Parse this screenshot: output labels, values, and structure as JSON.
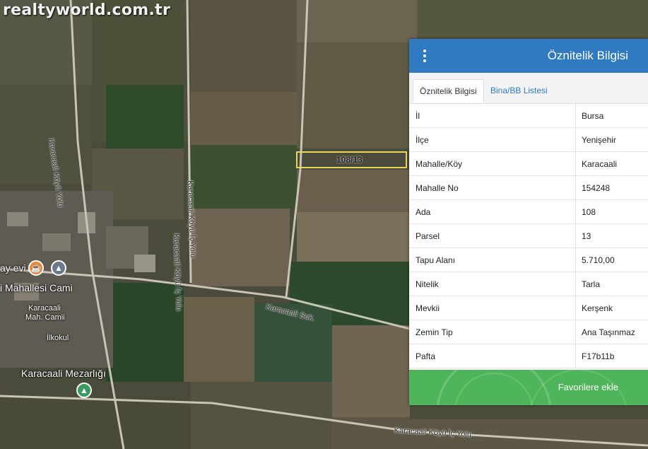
{
  "map": {
    "watermark": "realtyworld.com.tr",
    "parcel_label": "108/13",
    "labels": [
      {
        "text": "Karacaali Köyü Yolu"
      },
      {
        "text": "Karacaali Köyü İç Yolu"
      },
      {
        "text": "Karacaali Köyü İç Yolu"
      },
      {
        "text": "Karacaali Sok."
      },
      {
        "text": "Karacaali Köyü İç Yolu"
      },
      {
        "text": "ay evi"
      },
      {
        "text": "i Mahallesi Cami"
      },
      {
        "text": "Karacaali"
      },
      {
        "text": "Mah. Camii"
      },
      {
        "text": "İlkokul"
      },
      {
        "text": "Karacaali Mezarlığı"
      }
    ]
  },
  "panel": {
    "title": "Öznitelik Bilgisi",
    "tabs": [
      {
        "label": "Öznitelik Bilgisi",
        "active": true
      },
      {
        "label": "Bina/BB Listesi",
        "active": false
      }
    ],
    "rows": [
      {
        "key": "İl",
        "value": "Bursa"
      },
      {
        "key": "İlçe",
        "value": "Yenişehir"
      },
      {
        "key": "Mahalle/Köy",
        "value": "Karacaali"
      },
      {
        "key": "Mahalle No",
        "value": "154248"
      },
      {
        "key": "Ada",
        "value": "108"
      },
      {
        "key": "Parsel",
        "value": "13"
      },
      {
        "key": "Tapu Alanı",
        "value": "5.710,00"
      },
      {
        "key": "Nitelik",
        "value": "Tarla"
      },
      {
        "key": "Mevkii",
        "value": "Kerşenk"
      },
      {
        "key": "Zemin Tip",
        "value": "Ana Taşınmaz"
      },
      {
        "key": "Pafta",
        "value": "F17b11b"
      }
    ],
    "favorite_button": "Favorilere ekle"
  },
  "colors": {
    "header": "#2f7ac1",
    "button": "#4fb55a",
    "parcel_outline": "#e8d65a"
  }
}
